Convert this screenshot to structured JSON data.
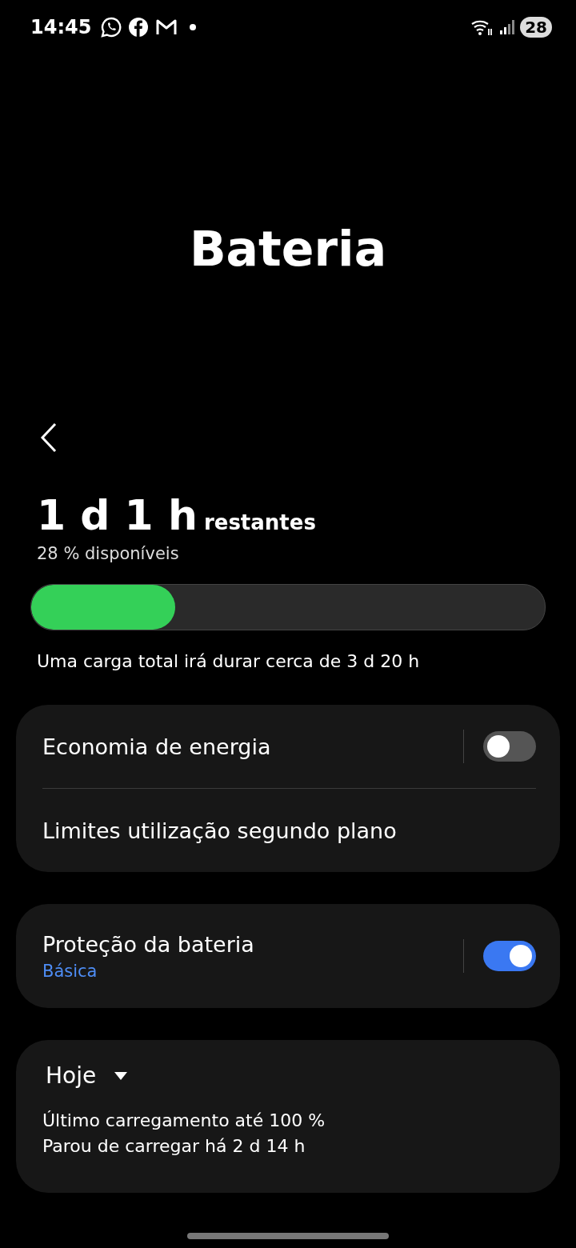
{
  "status_bar": {
    "time": "14:45",
    "battery": "28"
  },
  "title": "Bateria",
  "summary": {
    "remaining_value": "1 d 1 h",
    "remaining_label": "restantes",
    "available": "28 % disponíveis",
    "level": 0.28,
    "full_charge": "Uma carga total irá durar cerca de 3 d 20 h"
  },
  "cards": [
    {
      "rows": [
        {
          "kind": "toggle",
          "label": "Economia de energia",
          "on": false
        },
        {
          "kind": "link",
          "label": "Limites utilização segundo plano"
        }
      ]
    },
    {
      "rows": [
        {
          "kind": "toggle",
          "label": "Proteção da bateria",
          "subtitle": "Básica",
          "on": true
        }
      ]
    }
  ],
  "history": {
    "period": "Hoje",
    "lines": [
      "Último carregamento até 100 %",
      "Parou de carregar há 2 d 14 h"
    ]
  }
}
